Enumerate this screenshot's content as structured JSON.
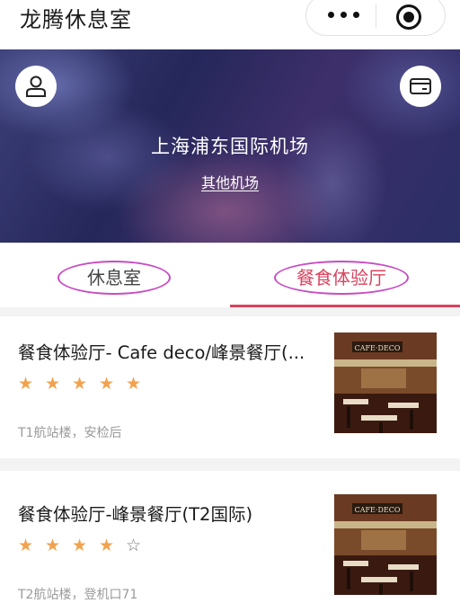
{
  "app": {
    "title": "龙腾休息室"
  },
  "hero": {
    "airport": "上海浦东国际机场",
    "other_link": "其他机场",
    "user_icon": "user-icon",
    "card_icon": "credit-card-icon"
  },
  "tabs": [
    {
      "label": "休息室",
      "active": false
    },
    {
      "label": "餐食体验厅",
      "active": true
    }
  ],
  "accent_color": "#d9435f",
  "star_color": "#f2a24e",
  "annotation_color": "#c84bc4",
  "list": [
    {
      "title": "餐食体验厅- Cafe deco/峰景餐厅(...",
      "rating": 5,
      "location": "T1航站楼，安检后",
      "thumb_sign": "CAFE·DECO"
    },
    {
      "title": "餐食体验厅-峰景餐厅(T2国际)",
      "rating": 4,
      "location": "T2航站楼，登机口71",
      "thumb_sign": "CAFE·DECO"
    }
  ]
}
